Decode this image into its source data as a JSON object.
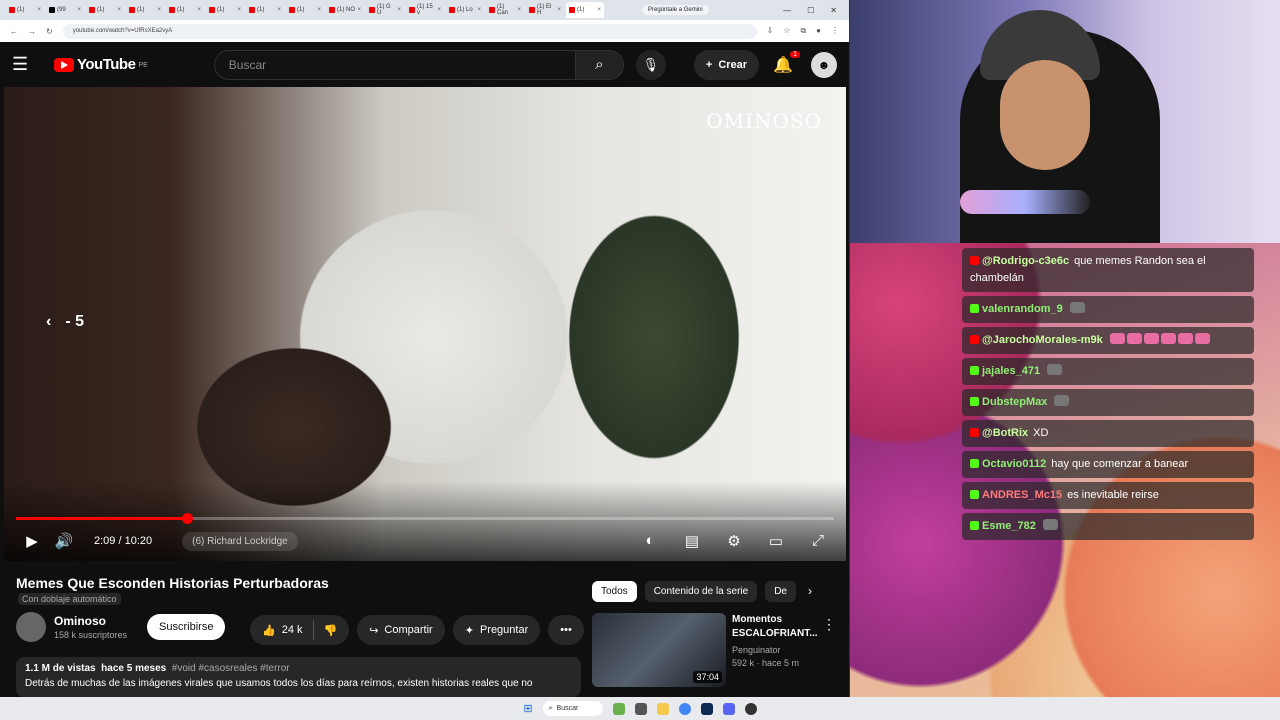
{
  "browser": {
    "tabs": [
      {
        "label": "(1)"
      },
      {
        "label": "(99"
      },
      {
        "label": "(1)"
      },
      {
        "label": "(1)"
      },
      {
        "label": "(1)"
      },
      {
        "label": "(1)"
      },
      {
        "label": "(1)"
      },
      {
        "label": "(1)"
      },
      {
        "label": "(1) NO"
      },
      {
        "label": "(1) G U"
      },
      {
        "label": "(1) 15 v"
      },
      {
        "label": "(1) Lo"
      },
      {
        "label": "(1) Can"
      },
      {
        "label": "(1) El H"
      },
      {
        "label": "(1)"
      }
    ],
    "gemini_label": "Pregúntale a Gemini",
    "url": "youtube.com/watch?v=UfRsXEa2vyA"
  },
  "youtube": {
    "logo_text": "YouTube",
    "country_code": "PE",
    "search_placeholder": "Buscar",
    "create_label": "Crear",
    "notification_count": "1",
    "player": {
      "watermark": "OMINOSO",
      "seek_hint": "- 5",
      "time": "2:09 / 10:20",
      "progress_fraction": 0.209,
      "chapter": "(6) Richard Lockridge"
    },
    "video_title": "Memes Que Esconden Historias Perturbadoras",
    "dub_label": "Con doblaje automático",
    "channel": {
      "name": "Ominoso",
      "subs": "158 k suscriptores",
      "subscribe_label": "Suscribirse"
    },
    "actions": {
      "likes": "24 k",
      "share": "Compartir",
      "ask": "Preguntar"
    },
    "description": {
      "views": "1.1 M de vistas",
      "age": "hace 5 meses",
      "tags": "#void #casosreales #terror",
      "text": "Detrás de muchas de las imágenes virales que usamos todos los días para reírnos, existen historias reales que no"
    },
    "chips": [
      "Todos",
      "Contenido de la serie",
      "De"
    ],
    "recommendation": {
      "title": "Momentos ESCALOFRIANT...",
      "channel": "Penguinator",
      "meta": "592 k · hace 5 m",
      "duration": "37:04"
    }
  },
  "chat": {
    "messages": [
      {
        "platform": "yt",
        "user": "@Rodrigo-c3e6c",
        "text": "que memes Randon sea el chambelán",
        "emotes": 0
      },
      {
        "platform": "kick",
        "user": "valenrandom_9",
        "text": "",
        "emotes": 1
      },
      {
        "platform": "yt",
        "user": "@JarochoMorales-m9k",
        "text": "",
        "emotes": 6
      },
      {
        "platform": "kick",
        "user": "jajales_471",
        "text": "",
        "emotes": 1
      },
      {
        "platform": "kick",
        "user": "DubstepMax",
        "text": "",
        "emotes": 1
      },
      {
        "platform": "yt",
        "user": "@BotRix",
        "text": "XD",
        "emotes": 0
      },
      {
        "platform": "kick",
        "user": "Octavio0112",
        "text": "hay que comenzar a banear",
        "emotes": 0
      },
      {
        "platform": "kick",
        "user": "ANDRES_Mc15",
        "text": "es inevitable reirse",
        "emotes": 0
      },
      {
        "platform": "kick",
        "user": "Esme_782",
        "text": "",
        "emotes": 1
      }
    ]
  },
  "taskbar": {
    "search_label": "Buscar"
  }
}
